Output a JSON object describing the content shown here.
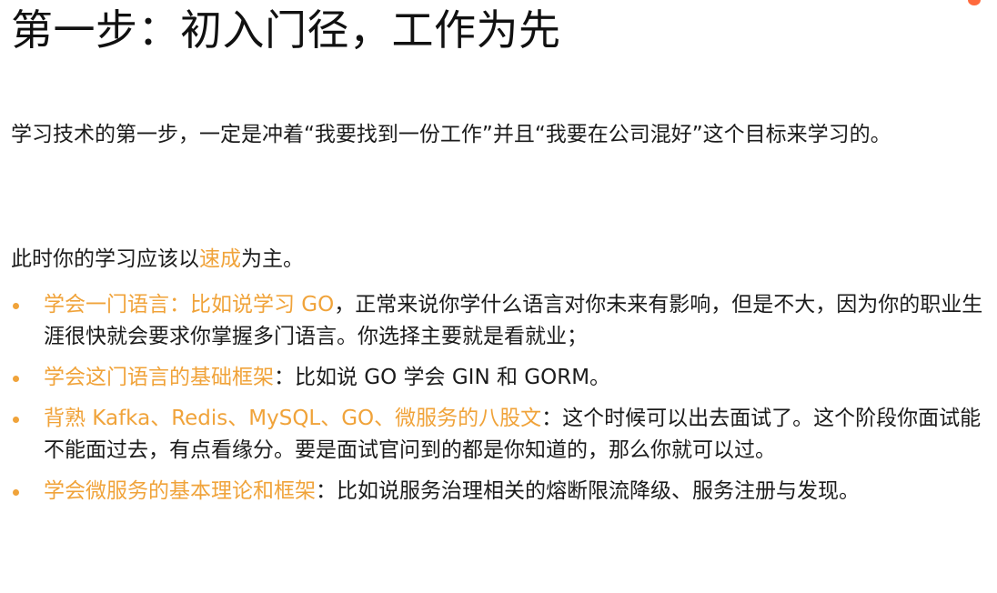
{
  "title": "第一步：初入门径，工作为先",
  "intro": {
    "line": "学习技术的第一步，一定是冲着“我要找到一份工作”并且“我要在公司混好”这个目标来学习的。"
  },
  "focus": {
    "prefix": "此时你的学习应该以",
    "highlight": "速成",
    "suffix": "为主。"
  },
  "items": [
    {
      "lead": "学会一门语言：比如说学习 GO",
      "text": "，正常来说你学什么语言对你未来有影响，但是不大，因为你的职业生涯很快就会要求你掌握多门语言。你选择主要就是看就业；"
    },
    {
      "lead": "学会这门语言的基础框架",
      "text": "：比如说 GO 学会 GIN 和 GORM。"
    },
    {
      "lead": "背熟 Kafka、Redis、MySQL、GO、微服务的八股文",
      "text": "：这个时候可以出去面试了。这个阶段你面试能不能面过去，有点看缘分。要是面试官问到的都是你知道的，那么你就可以过。"
    },
    {
      "lead": "学会微服务的基本理论和框架",
      "text": "：比如说服务治理相关的熔断限流降级、服务注册与发现。"
    }
  ],
  "colors": {
    "accent": "#f0a33a",
    "text": "#1c1c1c",
    "corner_dot": "#ff6a3d"
  }
}
